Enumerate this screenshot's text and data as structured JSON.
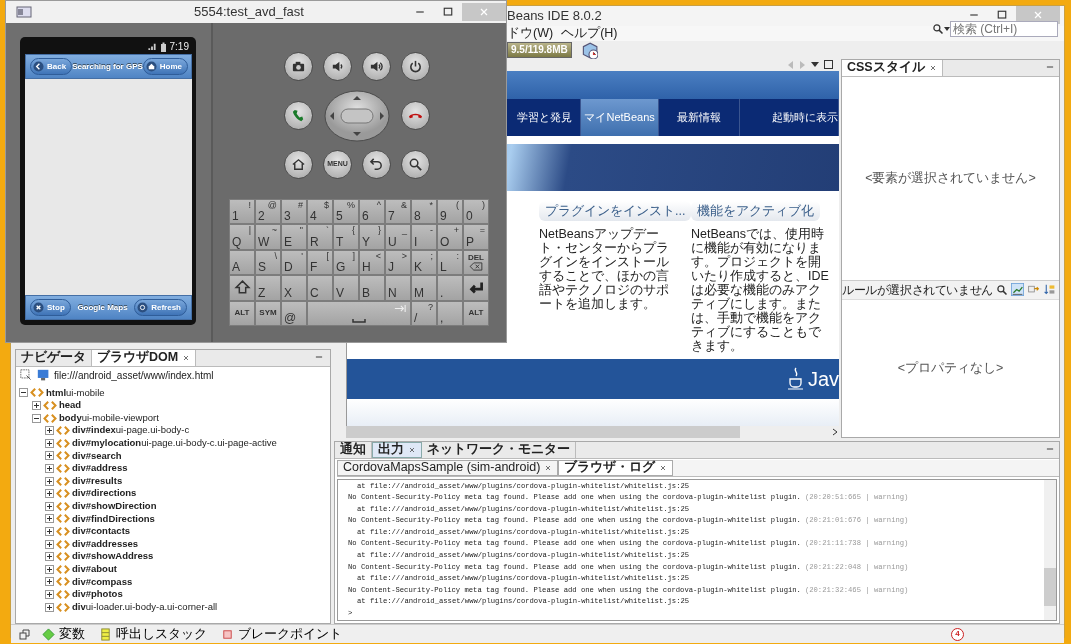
{
  "emulator": {
    "title": "5554:test_avd_fast",
    "phone": {
      "time": "7:19",
      "header": {
        "left": "Back",
        "title": "Searching for GPS",
        "right": "Home"
      },
      "footer": {
        "left": "Stop",
        "title": "Google Maps",
        "right": "Refresh"
      }
    },
    "menu_key": "MENU",
    "keyboard": [
      [
        {
          "kind": "char",
          "label": "1",
          "alt": "!"
        },
        {
          "kind": "char",
          "label": "2",
          "alt": "@"
        },
        {
          "kind": "char",
          "label": "3",
          "alt": "#"
        },
        {
          "kind": "char",
          "label": "4",
          "alt": "$"
        },
        {
          "kind": "char",
          "label": "5",
          "alt": "%"
        },
        {
          "kind": "char",
          "label": "6",
          "alt": "^"
        },
        {
          "kind": "char",
          "label": "7",
          "alt": "&"
        },
        {
          "kind": "char",
          "label": "8",
          "alt": "*"
        },
        {
          "kind": "char",
          "label": "9",
          "alt": "("
        },
        {
          "kind": "char",
          "label": "0",
          "alt": ")"
        }
      ],
      [
        {
          "kind": "char",
          "label": "Q",
          "alt": "|"
        },
        {
          "kind": "char",
          "label": "W",
          "alt": "~"
        },
        {
          "kind": "char",
          "label": "E",
          "alt": "\""
        },
        {
          "kind": "char",
          "label": "R",
          "alt": "`"
        },
        {
          "kind": "char",
          "label": "T",
          "alt": "{"
        },
        {
          "kind": "char",
          "label": "Y",
          "alt": "}"
        },
        {
          "kind": "char",
          "label": "U",
          "alt": "_"
        },
        {
          "kind": "char",
          "label": "I",
          "alt": "-"
        },
        {
          "kind": "char",
          "label": "O",
          "alt": "+"
        },
        {
          "kind": "char",
          "label": "P",
          "alt": "="
        }
      ],
      [
        {
          "kind": "char",
          "label": "A"
        },
        {
          "kind": "char",
          "label": "S",
          "alt": "\\"
        },
        {
          "kind": "char",
          "label": "D",
          "alt": "'"
        },
        {
          "kind": "char",
          "label": "F",
          "alt": "["
        },
        {
          "kind": "char",
          "label": "G",
          "alt": "]"
        },
        {
          "kind": "char",
          "label": "H",
          "alt": "<"
        },
        {
          "kind": "char",
          "label": "J",
          "alt": ">"
        },
        {
          "kind": "char",
          "label": "K",
          "alt": ";"
        },
        {
          "kind": "char",
          "label": "L",
          "alt": ":"
        },
        {
          "kind": "del",
          "label": "DEL"
        }
      ],
      [
        {
          "kind": "shift"
        },
        {
          "kind": "char",
          "label": "Z"
        },
        {
          "kind": "char",
          "label": "X"
        },
        {
          "kind": "char",
          "label": "C"
        },
        {
          "kind": "char",
          "label": "V"
        },
        {
          "kind": "char",
          "label": "B"
        },
        {
          "kind": "char",
          "label": "N"
        },
        {
          "kind": "char",
          "label": "M"
        },
        {
          "kind": "char",
          "label": "."
        },
        {
          "kind": "enter"
        }
      ],
      [
        {
          "kind": "mod",
          "label": "ALT"
        },
        {
          "kind": "mod",
          "label": "SYM"
        },
        {
          "kind": "char",
          "label": "@"
        },
        {
          "kind": "space"
        },
        {
          "kind": "char",
          "label": "/",
          "alt": "?"
        },
        {
          "kind": "char",
          "label": ","
        },
        {
          "kind": "mod",
          "label": "ALT"
        }
      ]
    ]
  },
  "ide": {
    "title": "Beans IDE 8.0.2",
    "menu": [
      "ドウ(W)",
      "ヘルプ(H)"
    ],
    "search": {
      "placeholder": "検索 (Ctrl+I)"
    },
    "memory": "9.5/119.8MB",
    "browser": {
      "nav": [
        {
          "label": "学習と発見",
          "selected": false
        },
        {
          "label": "マイNetBeans",
          "selected": true
        },
        {
          "label": "最新情報",
          "selected": false
        }
      ],
      "show_on_startup": "起動時に表示",
      "cards": [
        {
          "title": "プラグインをインスト...",
          "text": "NetBeansアップデート・センターからプラグインをインストールすることで、ほかの言語やテクノロジのサポートを追加します。"
        },
        {
          "title": "機能をアクティブ化",
          "text": "NetBeansでは、使用時に機能が有効になります。プロジェクトを開いたり作成すると、IDEは必要な機能のみアクティブにします。または、手動で機能をアクティブにすることもできます。"
        }
      ],
      "logo": "Jav"
    },
    "css_styles": {
      "tab": "CSSスタイル",
      "no_element": "<要素が選択されていません>",
      "rule": "ルールが選択されていません",
      "no_properties": "<プロパティなし>"
    },
    "navigator": {
      "tabs": [
        {
          "label": "ナビゲータ",
          "selected": false,
          "closable": false
        },
        {
          "label": "ブラウザDOM",
          "selected": true,
          "closable": true
        }
      ],
      "url": "file:///android_asset/www/index.html",
      "tree": [
        {
          "tag": "html",
          "attrs": "ui-mobile",
          "expanded": true,
          "children": [
            {
              "tag": "head",
              "expanded": false
            },
            {
              "tag": "body",
              "attrs": "ui-mobile-viewport",
              "expanded": true,
              "children": [
                {
                  "tag": "div#index",
                  "attrs": "ui-page.ui-body-c",
                  "expanded": false
                },
                {
                  "tag": "div#mylocation",
                  "attrs": "ui-page.ui-body-c.ui-page-active",
                  "expanded": false
                },
                {
                  "tag": "div#search",
                  "expanded": false
                },
                {
                  "tag": "div#address",
                  "expanded": false
                },
                {
                  "tag": "div#results",
                  "expanded": false
                },
                {
                  "tag": "div#directions",
                  "expanded": false
                },
                {
                  "tag": "div#showDirection",
                  "expanded": false
                },
                {
                  "tag": "div#findDirections",
                  "expanded": false
                },
                {
                  "tag": "div#contacts",
                  "expanded": false
                },
                {
                  "tag": "div#addresses",
                  "expanded": false
                },
                {
                  "tag": "div#showAddress",
                  "expanded": false
                },
                {
                  "tag": "div#about",
                  "expanded": false
                },
                {
                  "tag": "div#compass",
                  "expanded": false
                },
                {
                  "tag": "div#photos",
                  "expanded": false
                },
                {
                  "tag": "div",
                  "attrs": "ui-loader.ui-body-a.ui-corner-all",
                  "expanded": false
                }
              ]
            }
          ]
        }
      ]
    },
    "output": {
      "tabs": [
        {
          "label": "通知",
          "selected": false,
          "closable": false
        },
        {
          "label": "出力",
          "selected": true,
          "closable": true
        },
        {
          "label": "ネットワーク・モニター",
          "selected": false,
          "closable": false
        }
      ],
      "subtabs": [
        {
          "label": "CordovaMapsSample (sim-android)",
          "selected": false,
          "closable": true
        },
        {
          "label": "ブラウザ・ログ",
          "selected": true,
          "closable": true
        }
      ],
      "log": [
        {
          "kind": "trace",
          "text": "at file:///android_asset/www/plugins/cordova-plugin-whitelist/whitelist.js:25"
        },
        {
          "kind": "warning",
          "text": "No Content-Security-Policy meta tag found. Please add one when using the cordova-plugin-whitelist plugin.",
          "meta": "(20:20:51:665 | warning)"
        },
        {
          "kind": "trace",
          "text": "at file:///android_asset/www/plugins/cordova-plugin-whitelist/whitelist.js:25"
        },
        {
          "kind": "warning",
          "text": "No Content-Security-Policy meta tag found. Please add one when using the cordova-plugin-whitelist plugin.",
          "meta": "(20:21:01:676 | warning)"
        },
        {
          "kind": "trace",
          "text": "at file:///android_asset/www/plugins/cordova-plugin-whitelist/whitelist.js:25"
        },
        {
          "kind": "warning",
          "text": "No Content-Security-Policy meta tag found. Please add one when using the cordova-plugin-whitelist plugin.",
          "meta": "(20:21:11:738 | warning)"
        },
        {
          "kind": "trace",
          "text": "at file:///android_asset/www/plugins/cordova-plugin-whitelist/whitelist.js:25"
        },
        {
          "kind": "warning",
          "text": "No Content-Security-Policy meta tag found. Please add one when using the cordova-plugin-whitelist plugin.",
          "meta": "(20:21:22:048 | warning)"
        },
        {
          "kind": "trace",
          "text": "at file:///android_asset/www/plugins/cordova-plugin-whitelist/whitelist.js:25"
        },
        {
          "kind": "warning",
          "text": "No Content-Security-Policy meta tag found. Please add one when using the cordova-plugin-whitelist plugin.",
          "meta": "(20:21:32:465 | warning)"
        },
        {
          "kind": "trace",
          "text": "at file:///android_asset/www/plugins/cordova-plugin-whitelist/whitelist.js:25"
        }
      ],
      "prompt": ">"
    },
    "status_bar": {
      "tabs": [
        {
          "kind": "variables",
          "label": "変数"
        },
        {
          "kind": "call_stack",
          "label": "呼出しスタック"
        },
        {
          "kind": "breakpoints",
          "label": "ブレークポイント"
        }
      ],
      "notifications": "4"
    }
  }
}
